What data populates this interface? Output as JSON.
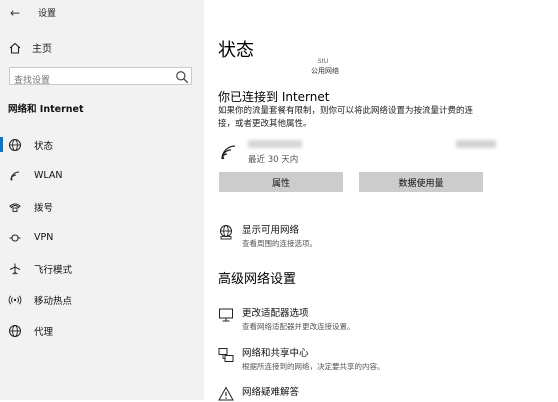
{
  "window": {
    "title": "设置"
  },
  "sidebar": {
    "home_label": "主页",
    "search_placeholder": "查找设置",
    "section_title": "网络和 Internet",
    "items": [
      {
        "label": "状态",
        "icon": "globe-icon",
        "active": true
      },
      {
        "label": "WLAN",
        "icon": "wifi-icon"
      },
      {
        "label": "拨号",
        "icon": "phone-icon"
      },
      {
        "label": "VPN",
        "icon": "vpn-icon"
      },
      {
        "label": "飞行模式",
        "icon": "airplane-icon"
      },
      {
        "label": "移动热点",
        "icon": "hotspot-icon"
      },
      {
        "label": "代理",
        "icon": "globe-icon"
      }
    ]
  },
  "main": {
    "title": "状态",
    "network_name": "StU",
    "network_type": "公用网络",
    "connected_heading": "你已连接到 Internet",
    "description": "如果你的流量套餐有限制，则你可以将此网络设置为按流量计费的连接，或者更改其他属性。",
    "since": "最近 30 天内",
    "properties_button": "属性",
    "data_usage_button": "数据使用量",
    "show_networks": {
      "title": "显示可用网络",
      "subtitle": "查看周围的连接选项。"
    },
    "advanced_heading": "高级网络设置",
    "adapter_options": {
      "title": "更改适配器选项",
      "subtitle": "查看网络适配器并更改连接设置。"
    },
    "sharing_center": {
      "title": "网络和共享中心",
      "subtitle": "根据所连接到的网络，决定要共享的内容。"
    },
    "troubleshooter": {
      "title": "网络疑难解答"
    }
  }
}
